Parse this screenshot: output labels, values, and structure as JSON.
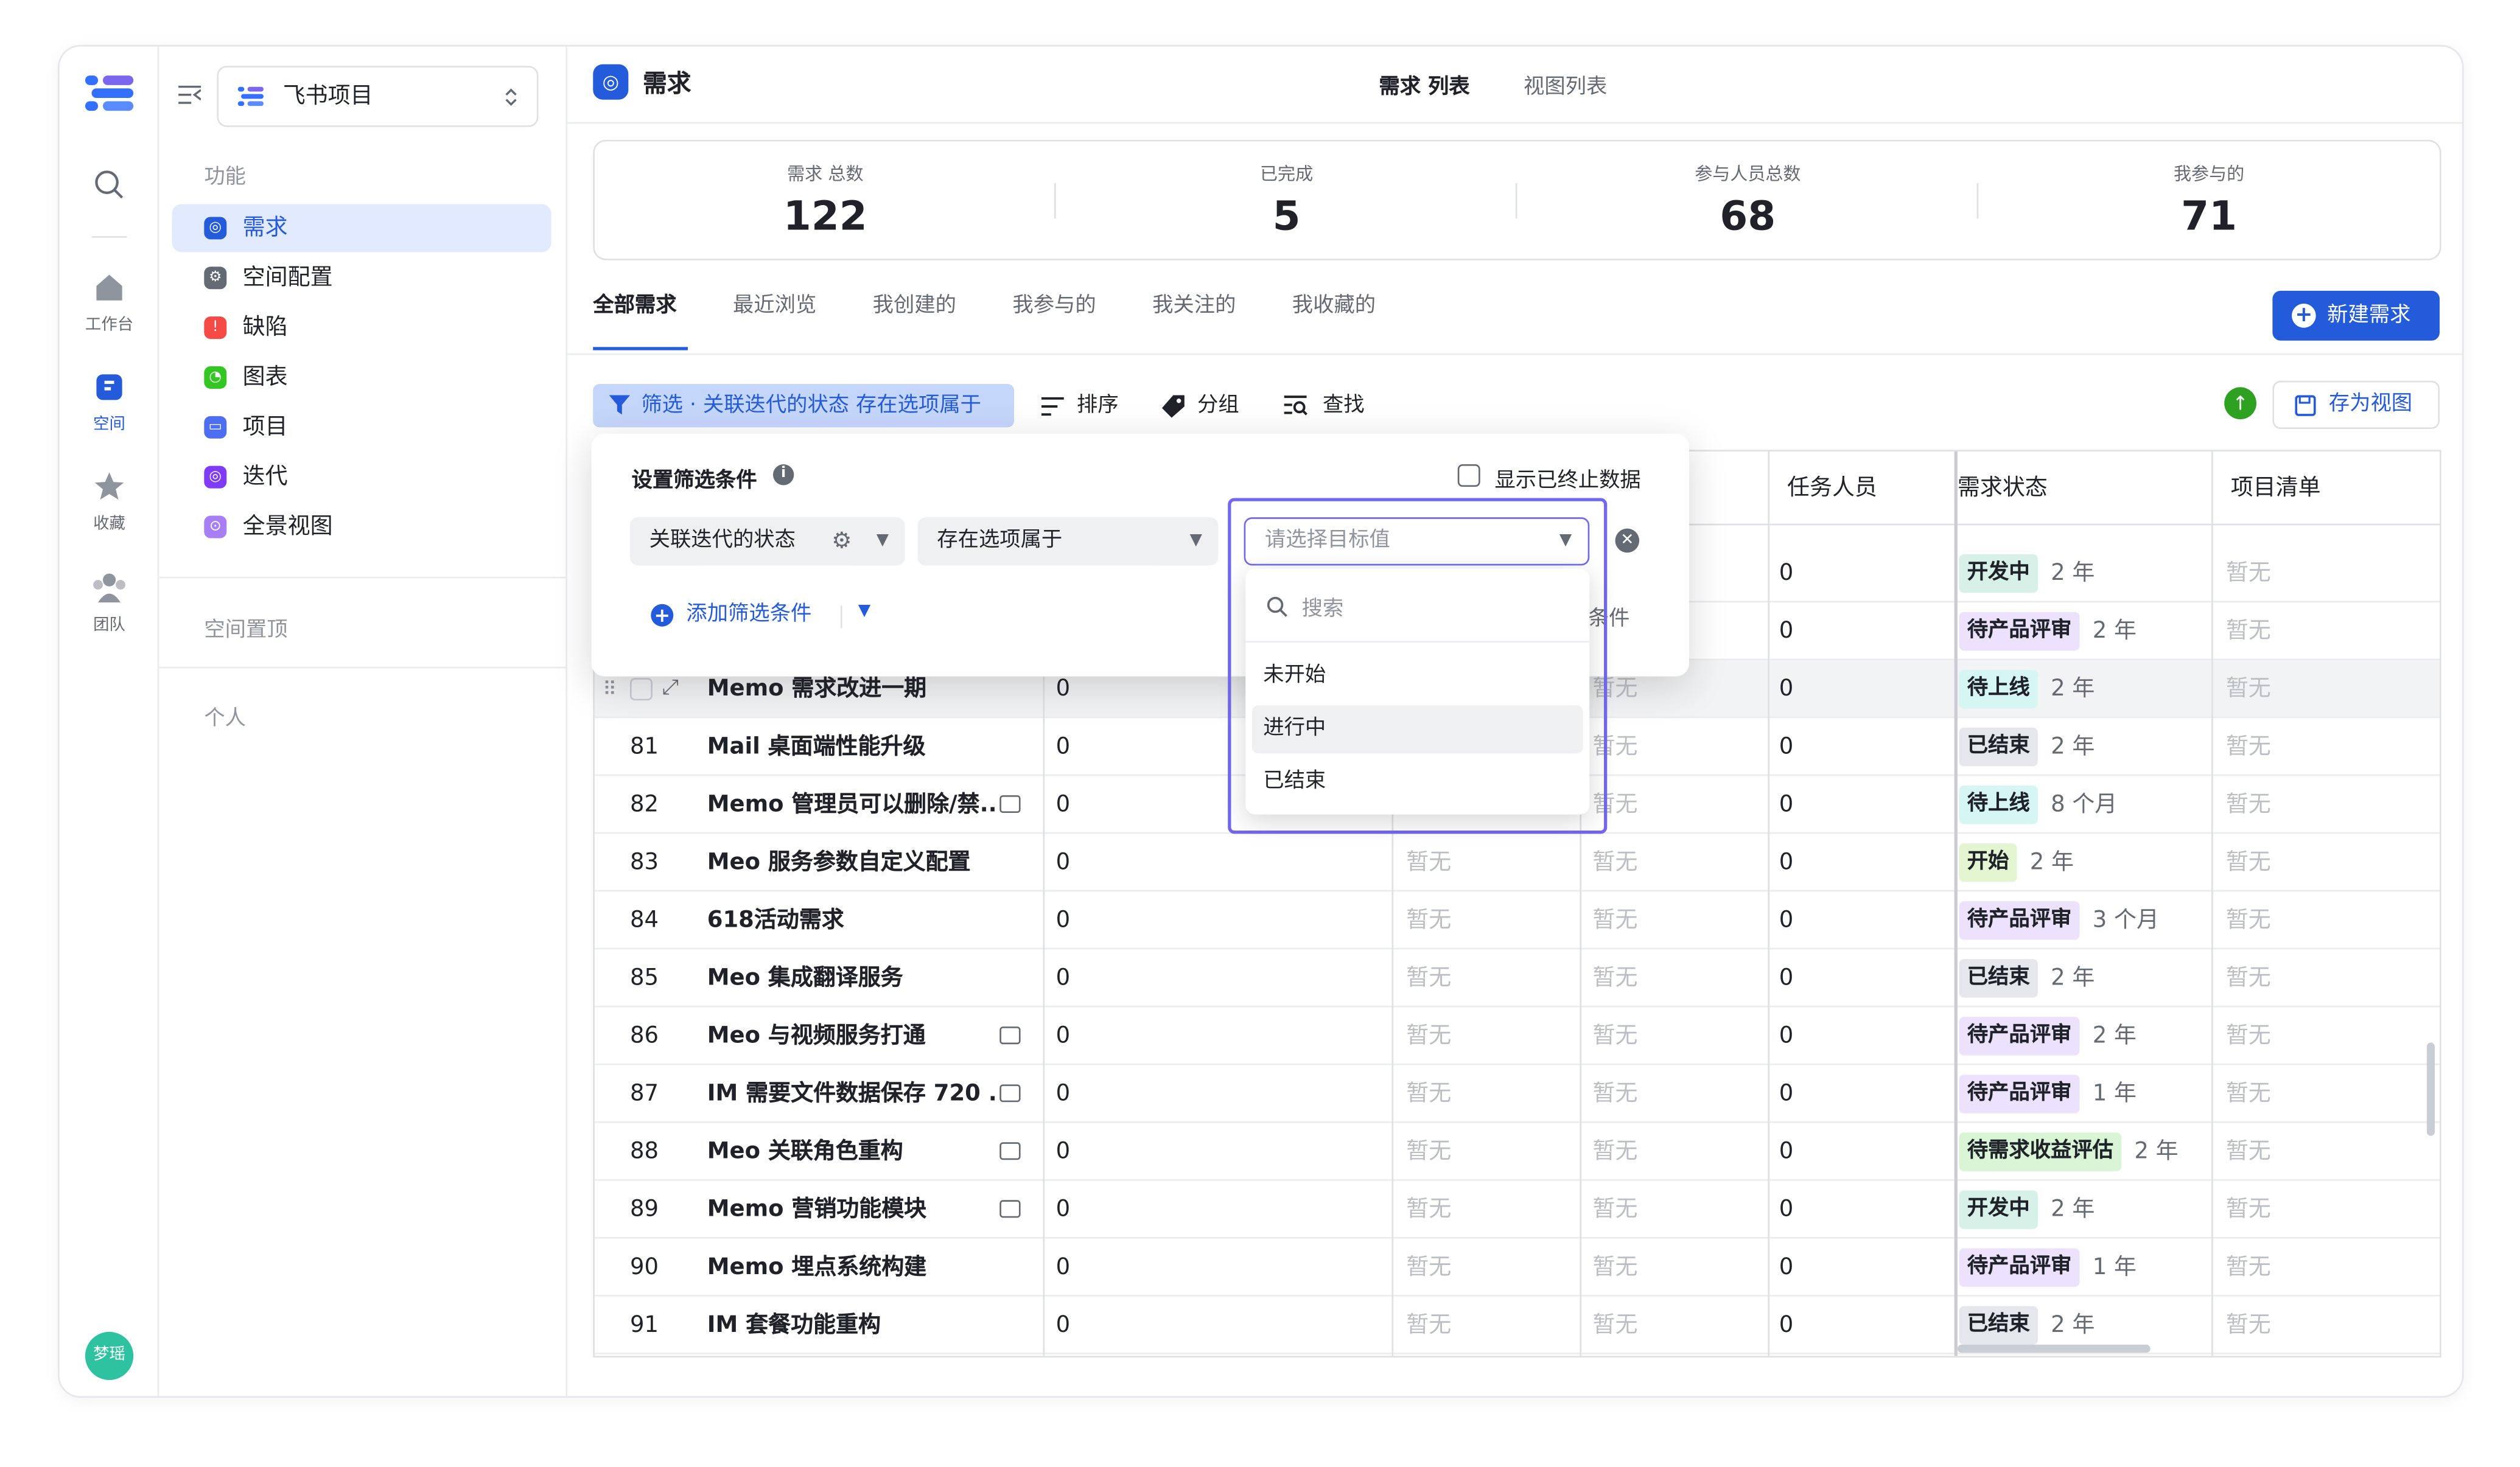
{
  "rail": {
    "items": [
      {
        "label": "工作台",
        "icon": "home-icon"
      },
      {
        "label": "空间",
        "icon": "space-icon"
      },
      {
        "label": "收藏",
        "icon": "star-icon"
      },
      {
        "label": "团队",
        "icon": "team-icon"
      }
    ],
    "avatar": "梦瑶"
  },
  "sidebar": {
    "project_name": "飞书项目",
    "section_function": "功能",
    "items": [
      {
        "label": "需求",
        "color": "#245bdb"
      },
      {
        "label": "空间配置",
        "color": "#646a73"
      },
      {
        "label": "缺陷",
        "color": "#f54a45"
      },
      {
        "label": "图表",
        "color": "#34c724"
      },
      {
        "label": "项目",
        "color": "#4e6ef2"
      },
      {
        "label": "迭代",
        "color": "#7f3bf5"
      },
      {
        "label": "全景视图",
        "color": "#a77ef5"
      }
    ],
    "section_pinned": "空间置顶",
    "section_personal": "个人"
  },
  "header": {
    "title": "需求",
    "tabs": [
      "需求 列表",
      "视图列表"
    ]
  },
  "stats": [
    {
      "label": "需求 总数",
      "value": "122"
    },
    {
      "label": "已完成",
      "value": "5"
    },
    {
      "label": "参与人员总数",
      "value": "68"
    },
    {
      "label": "我参与的",
      "value": "71"
    }
  ],
  "tabs": [
    "全部需求",
    "最近浏览",
    "我创建的",
    "我参与的",
    "我关注的",
    "我收藏的"
  ],
  "new_button": "新建需求",
  "toolbar": {
    "filter": "筛选 · 关联迭代的状态 存在选项属于",
    "sort": "排序",
    "group": "分组",
    "find": "查找",
    "save_view": "存为视图"
  },
  "columns": {
    "assignee": "任务人员",
    "status": "需求状态",
    "checklist": "项目清单"
  },
  "placeholder": "暂无",
  "status_colors": {
    "开发中": "#d7f0e8",
    "待产品评审": "#ece2fe",
    "待上线": "#d5f6f2",
    "已结束": "#e4e7ec",
    "开始": "#e4f5d1",
    "待需求收益评估": "#d9f5d6"
  },
  "rows": [
    {
      "id": "",
      "name": "",
      "num": "0",
      "count": "0",
      "status": "开发中",
      "age": "2 年"
    },
    {
      "id": "",
      "name": "",
      "num": "0",
      "count": "0",
      "status": "待产品评审",
      "age": "2 年"
    },
    {
      "id": "",
      "name": "Memo 需求改进一期",
      "num": "0",
      "count": "0",
      "status": "待上线",
      "age": "2 年"
    },
    {
      "id": "81",
      "name": "Mail 桌面端性能升级",
      "num": "0",
      "count": "0",
      "status": "已结束",
      "age": "2 年"
    },
    {
      "id": "82",
      "name": "Memo 管理员可以删除/禁...",
      "num": "0",
      "count": "0",
      "status": "待上线",
      "age": "8 个月"
    },
    {
      "id": "83",
      "name": "Meo 服务参数自定义配置",
      "num": "0",
      "count": "0",
      "status": "开始",
      "age": "2 年"
    },
    {
      "id": "84",
      "name": "618活动需求",
      "num": "0",
      "count": "0",
      "status": "待产品评审",
      "age": "3 个月"
    },
    {
      "id": "85",
      "name": "Meo 集成翻译服务",
      "num": "0",
      "count": "0",
      "status": "已结束",
      "age": "2 年"
    },
    {
      "id": "86",
      "name": "Meo 与视频服务打通",
      "num": "0",
      "count": "0",
      "status": "待产品评审",
      "age": "2 年"
    },
    {
      "id": "87",
      "name": "IM 需要文件数据保存 720 ...",
      "num": "0",
      "count": "0",
      "status": "待产品评审",
      "age": "1 年"
    },
    {
      "id": "88",
      "name": "Meo 关联角色重构",
      "num": "0",
      "count": "0",
      "status": "待需求收益评估",
      "age": "2 年"
    },
    {
      "id": "89",
      "name": "Memo 营销功能模块",
      "num": "0",
      "count": "0",
      "status": "开发中",
      "age": "2 年"
    },
    {
      "id": "90",
      "name": "Memo 埋点系统构建",
      "num": "0",
      "count": "0",
      "status": "待产品评审",
      "age": "1 年"
    },
    {
      "id": "91",
      "name": "IM 套餐功能重构",
      "num": "0",
      "count": "0",
      "status": "已结束",
      "age": "2 年"
    }
  ],
  "filter_panel": {
    "title": "设置筛选条件",
    "show_terminated": "显示已终止数据",
    "field": "关联迭代的状态",
    "operator": "存在选项属于",
    "value_placeholder": "请选择目标值",
    "add_condition": "添加筛选条件",
    "hidden_text": "条件",
    "search_placeholder": "搜索",
    "options": [
      "未开始",
      "进行中",
      "已结束"
    ]
  },
  "help": "帮助"
}
